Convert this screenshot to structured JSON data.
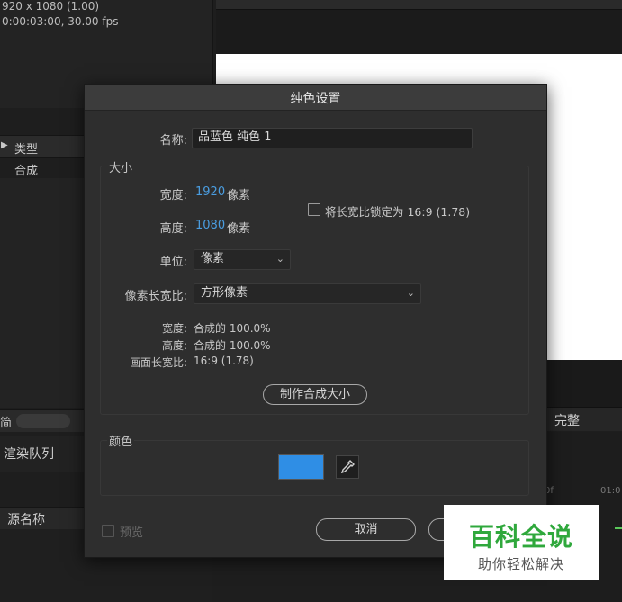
{
  "background": {
    "project_info_line1": "920 x 1080 (1.00)",
    "project_info_line2": "0:00:03:00, 30.00 fps",
    "project_header_col": "类型",
    "project_row_type": "合成",
    "project_footer_partial": "简",
    "render_queue_tab": "渲染队列",
    "source_name_col": "源名称",
    "resolution_label": "完整",
    "ruler_tick_1": "0f",
    "ruler_tick_2": "01:0"
  },
  "dialog": {
    "title": "纯色设置",
    "name_label": "名称:",
    "name_value": "品蓝色 纯色 1",
    "size_group_title": "大小",
    "width_label": "宽度:",
    "width_value": "1920",
    "width_unit": "像素",
    "height_label": "高度:",
    "height_value": "1080",
    "height_unit": "像素",
    "lock_aspect_label": "将长宽比锁定为 16:9 (1.78)",
    "lock_aspect_checked": false,
    "units_label": "单位:",
    "units_value": "像素",
    "pixel_aspect_label": "像素长宽比:",
    "pixel_aspect_value": "方形像素",
    "info_width_label": "宽度:",
    "info_width_value": "合成的 100.0%",
    "info_height_label": "高度:",
    "info_height_value": "合成的 100.0%",
    "info_frame_aspect_label": "画面长宽比:",
    "info_frame_aspect_value": "16:9 (1.78)",
    "make_comp_size_button": "制作合成大小",
    "color_group_title": "颜色",
    "color_value": "#2f8ee5",
    "preview_label": "预览",
    "cancel_button": "取消"
  },
  "watermark": {
    "main": "百科全说",
    "sub": "助你轻松解决"
  }
}
